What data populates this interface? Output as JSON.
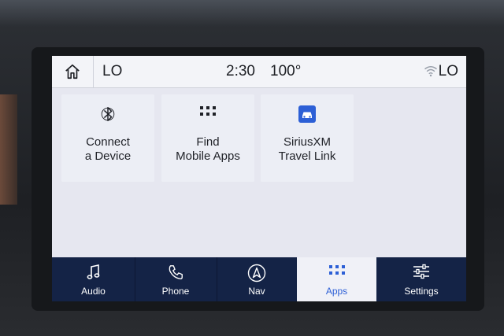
{
  "status_bar": {
    "home_icon": "home-icon",
    "climate_left": "LO",
    "time": "2:30",
    "outside_temp": "100°",
    "climate_right": "LO",
    "wifi_icon": "wifi-icon"
  },
  "apps": [
    {
      "line1": "Connect",
      "line2": "a Device",
      "icon": "bluetooth-icon"
    },
    {
      "line1": "Find",
      "line2": "Mobile Apps",
      "icon": "grid-icon"
    },
    {
      "line1": "SiriusXM",
      "line2": "Travel Link",
      "icon": "car-icon"
    }
  ],
  "nav": [
    {
      "label": "Audio",
      "icon": "music-note-icon"
    },
    {
      "label": "Phone",
      "icon": "phone-icon"
    },
    {
      "label": "Nav",
      "icon": "navigation-icon"
    },
    {
      "label": "Apps",
      "icon": "apps-grid-icon",
      "active": true
    },
    {
      "label": "Settings",
      "icon": "sliders-icon"
    }
  ],
  "colors": {
    "nav_background": "#142346",
    "active_accent": "#2c5fd6",
    "screen_background": "#e6e7f0"
  }
}
